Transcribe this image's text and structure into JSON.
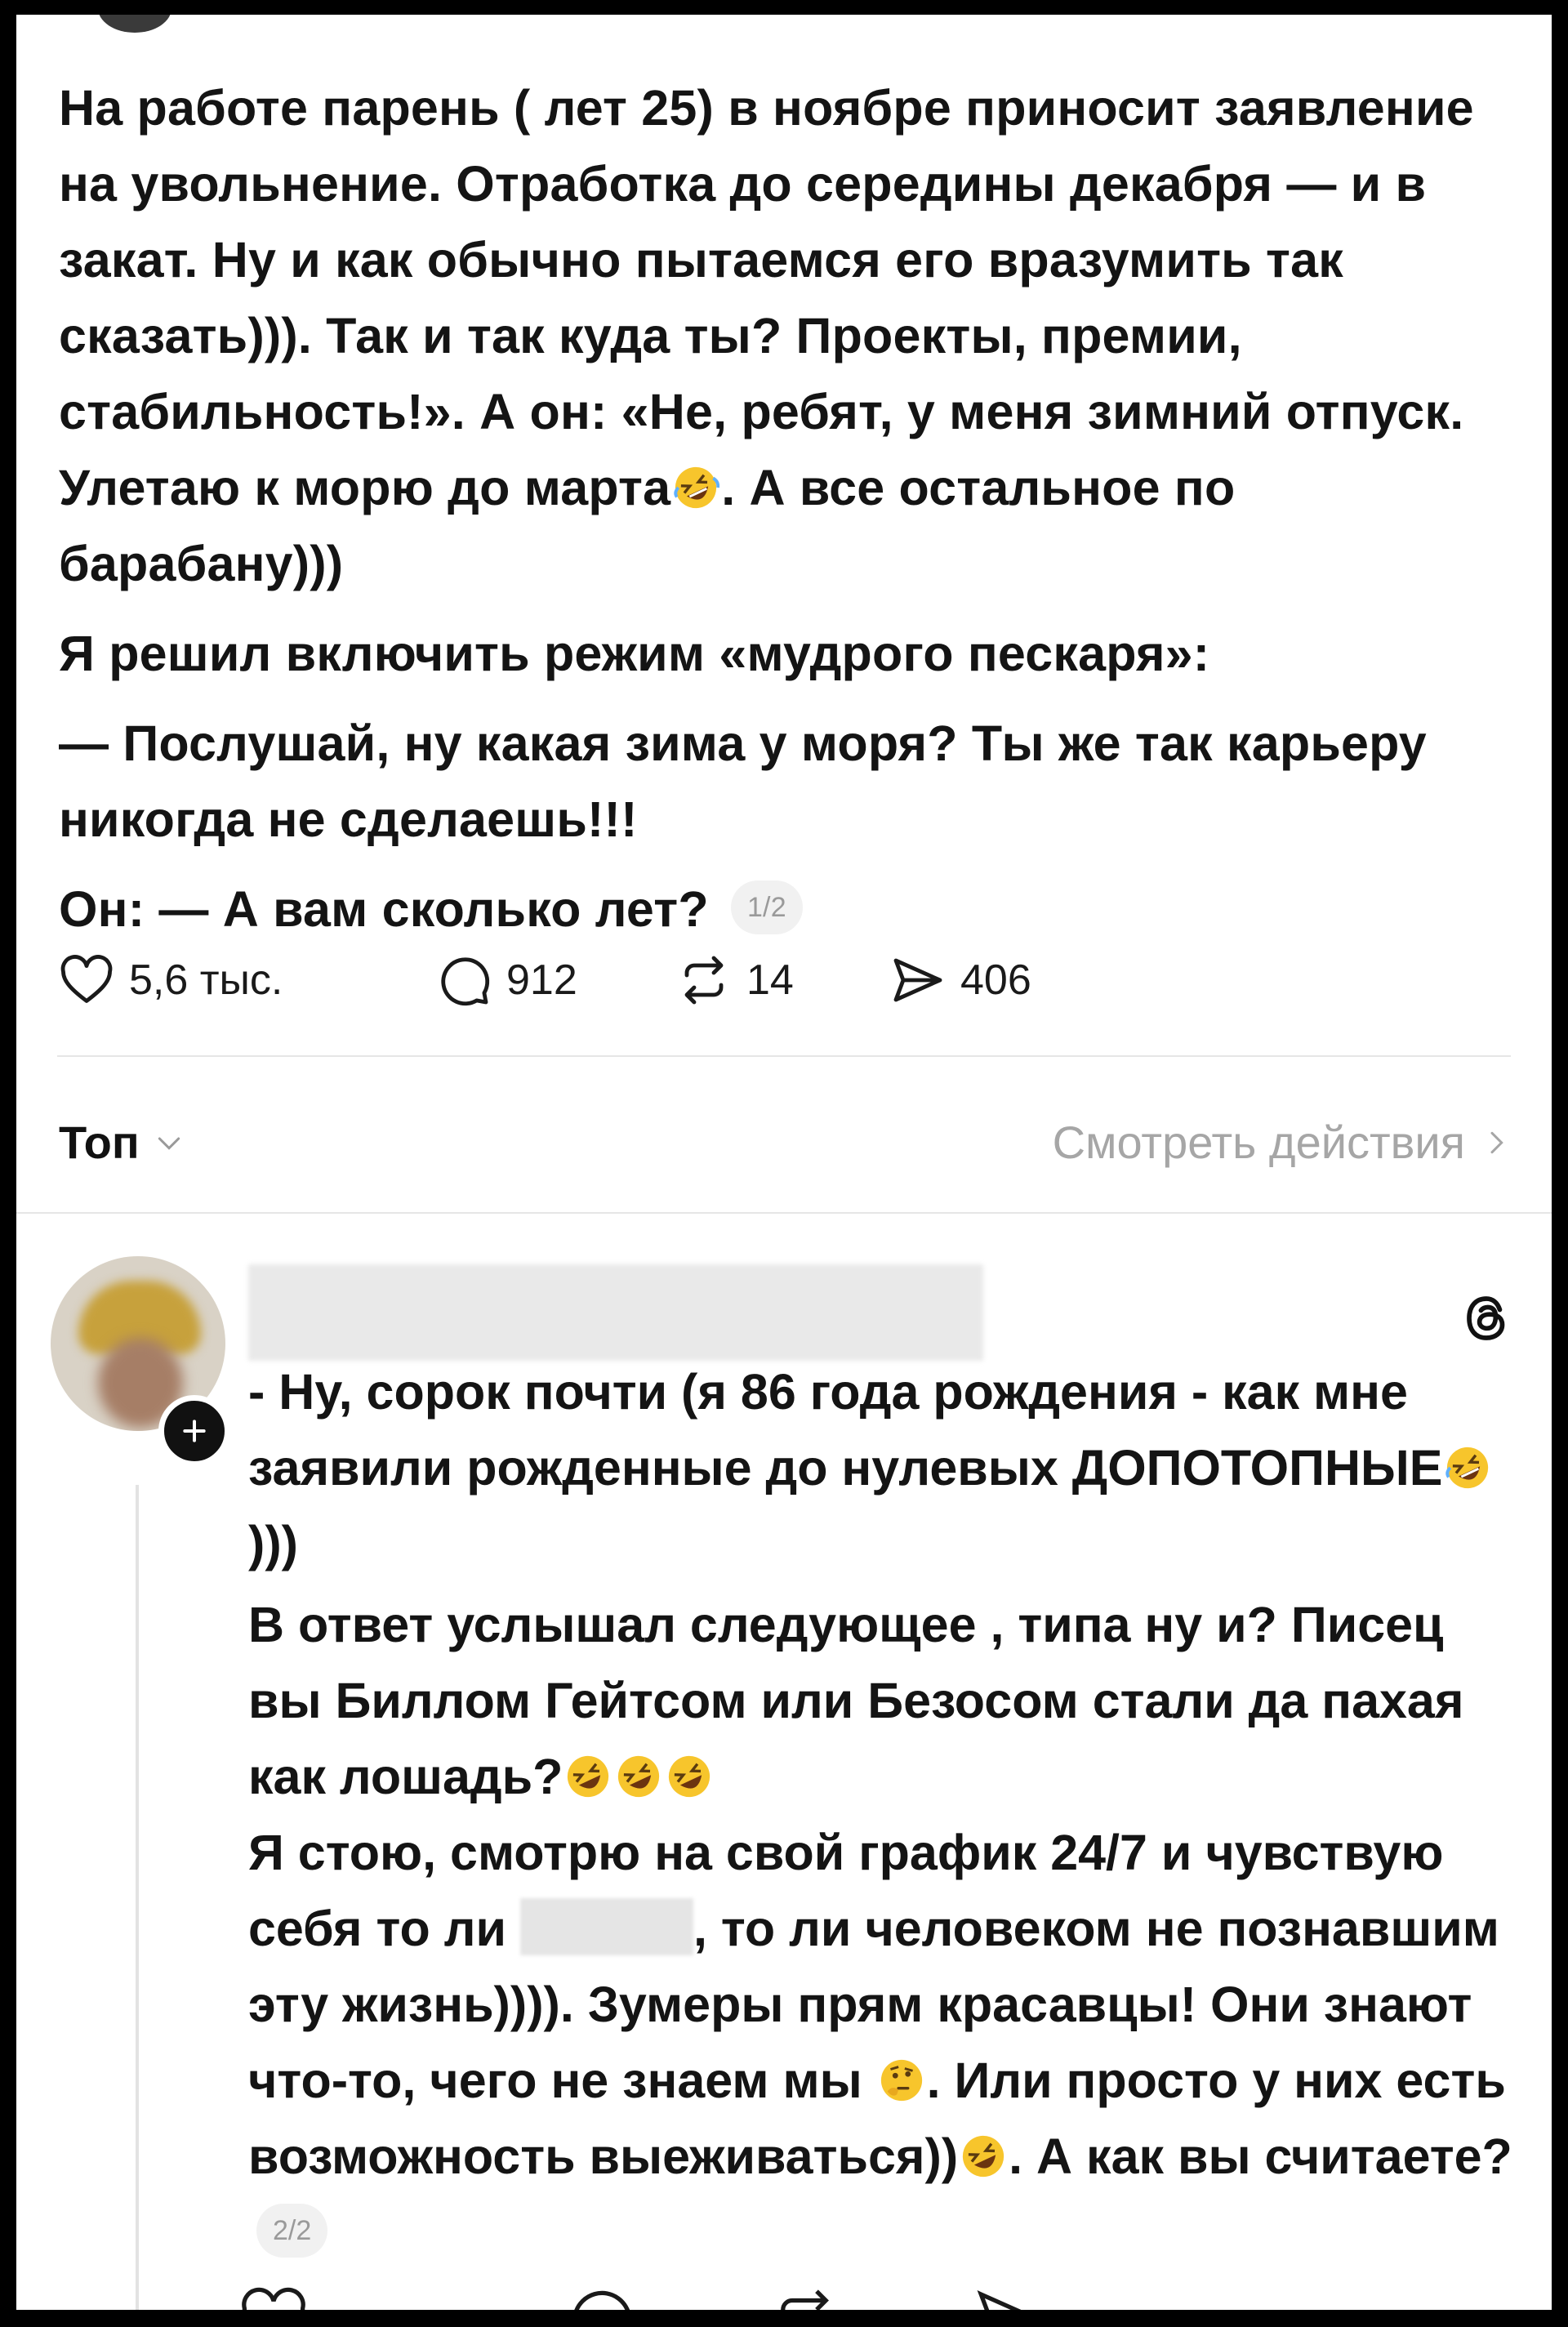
{
  "colors": {
    "background": "#ffffff",
    "text": "#141414",
    "muted": "#a6a6a6",
    "frame": "#000000"
  },
  "post": {
    "paragraphs": [
      {
        "text_1": "На работе парень ( лет 25)  в ноябре приносит заявление на увольнение. Отработка до середины декабря — и в закат. Ну и как обычно пытаемся его вразумить так сказать))). Так и так куда ты? Проекты, премии, стабильность!». А он: «Не, ребят, у меня зимний отпуск. Улетаю к морю до марта",
        "emoji": "rolling-on-floor-laughing",
        "text_2": ". А все остальное по барабану)))"
      },
      {
        "text": "Я решил включить режим «мудрого пескаря»:"
      },
      {
        "text": "— Послушай, ну какая зима у моря? Ты же так карьеру никогда не сделаешь!!!"
      },
      {
        "text": "Он: — А вам сколько лет?"
      }
    ],
    "pager": "1/2",
    "actions": {
      "likes": {
        "icon": "heart-icon",
        "count": "5,6 тыс."
      },
      "replies": {
        "icon": "comment-icon",
        "count": "912"
      },
      "reposts": {
        "icon": "repost-icon",
        "count": "14"
      },
      "shares": {
        "icon": "share-icon",
        "count": "406"
      }
    }
  },
  "replies_bar": {
    "sort_label": "Топ",
    "sort_icon": "chevron-down-icon",
    "view_activity_label": "Смотреть действия",
    "view_activity_icon": "chevron-right-icon"
  },
  "reply": {
    "app_icon": "threads-logo-icon",
    "follow_icon": "plus-icon",
    "paragraphs": [
      {
        "text": "- Ну, сорок почти (я 86 года рождения - как мне заявили рожденные до нулевых ДОПОТОПНЫЕ",
        "emoji": "rolling-on-floor-laughing",
        "tail": " )))"
      },
      {
        "text": " В ответ услышал следующее , типа ну и? Писец вы Биллом Гейтсом или Безосом стали да пахая как лошадь?",
        "emoji": "rolling-on-floor-laughing x3"
      },
      {
        "text_1": "Я стою, смотрю на свой график 24/7 и чувствую себя  то ли ",
        "redacted_word": "[скрыто]",
        "text_2": ", то ли человеком не познавшим эту жизнь)))). Зумеры прям красавцы! Они знают что-то, чего не знаем мы "
      },
      {
        "emoji": "thinking-face",
        "text_1": ". Или просто у них есть возможность выеживаться))",
        "emoji_2": "rolling-on-floor-laughing",
        "text_2": ". А как вы считаете?"
      }
    ],
    "pager": "2/2"
  }
}
